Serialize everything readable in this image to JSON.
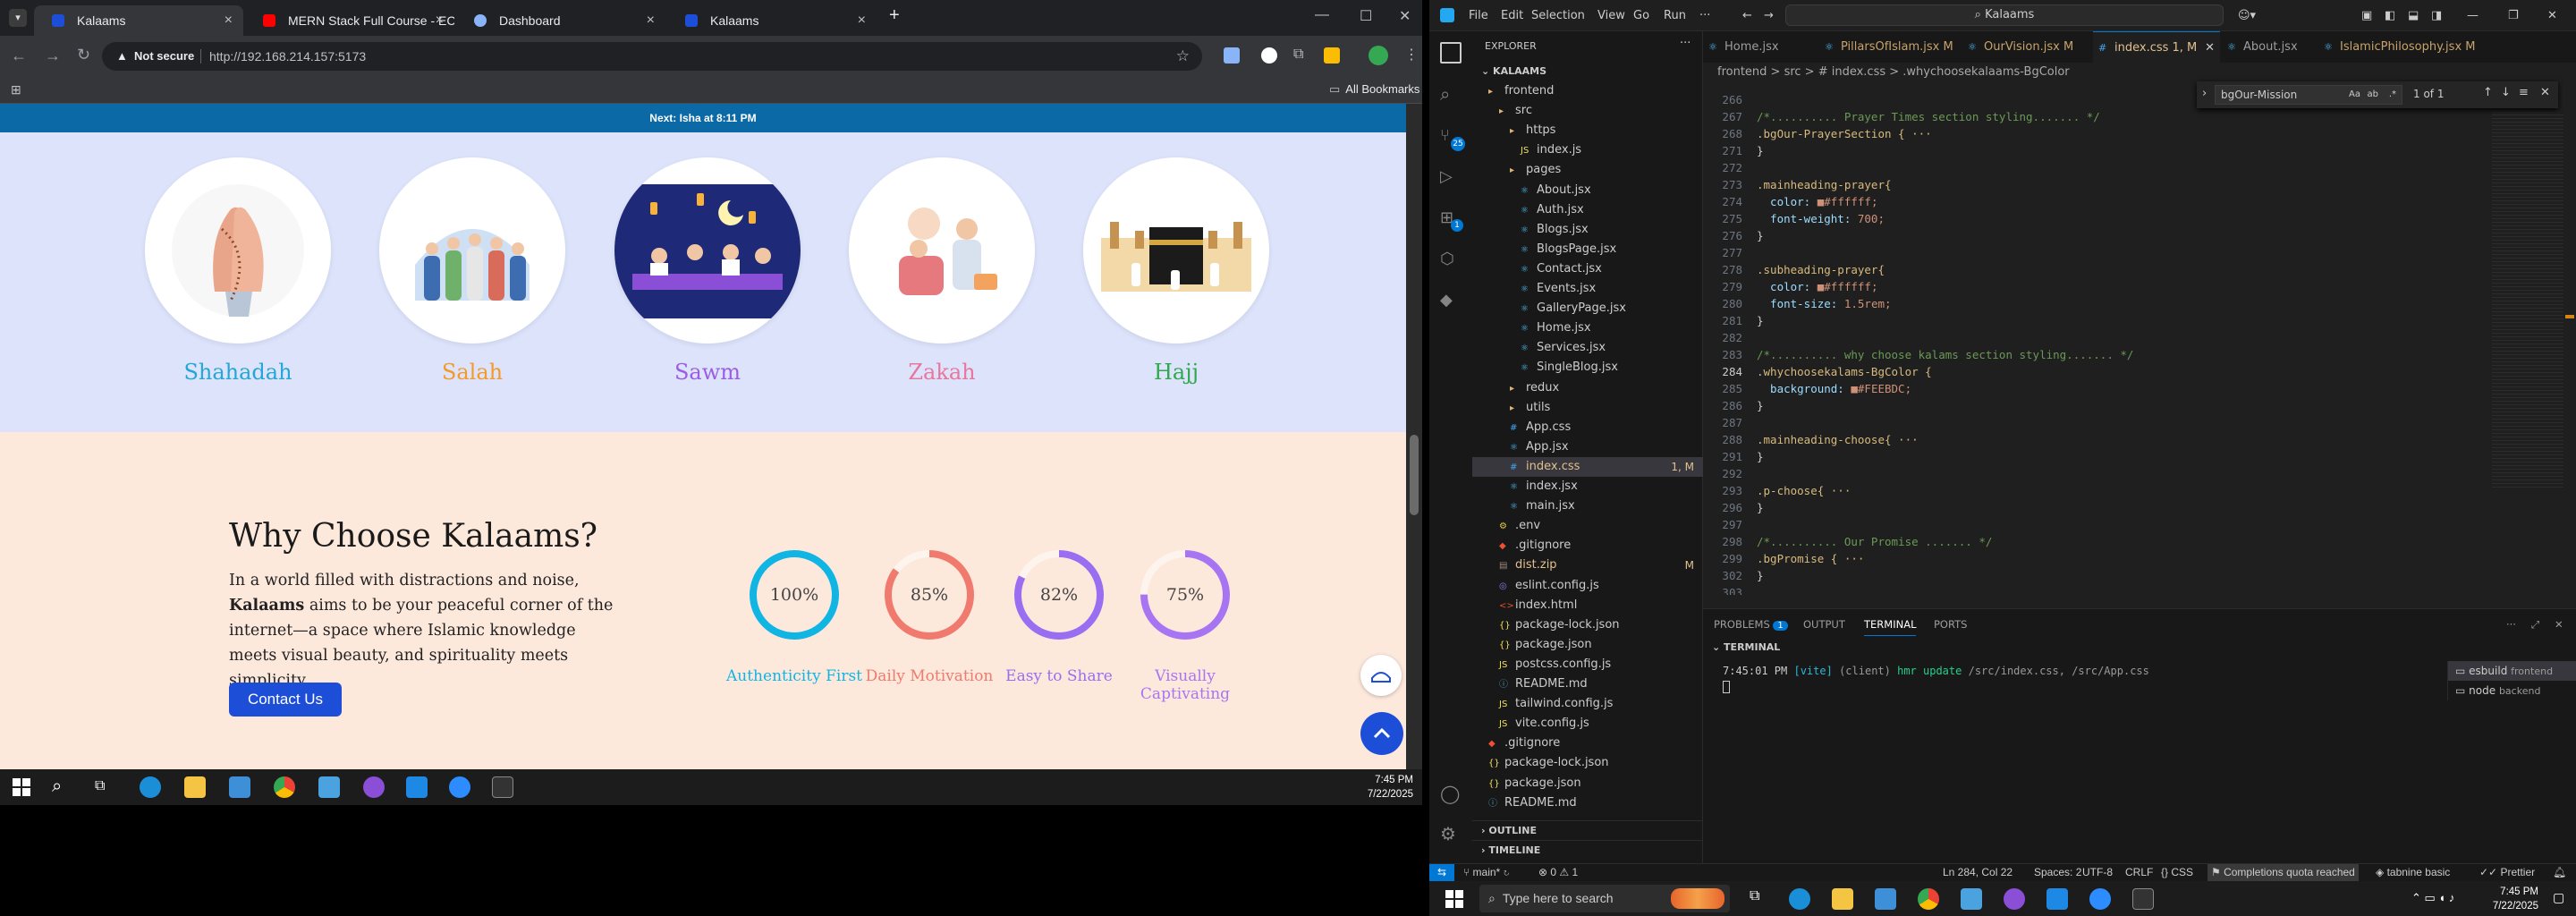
{
  "chrome": {
    "tabs": [
      {
        "title": "Kalaams",
        "active": true,
        "favicon_color": "#1d4ed8"
      },
      {
        "title": "MERN Stack Full Course - ECom",
        "active": false,
        "favicon_color": "#ff0000"
      },
      {
        "title": "Dashboard",
        "active": false,
        "favicon_color": "#8ab4f8"
      },
      {
        "title": "Kalaams",
        "active": false,
        "favicon_color": "#1d4ed8"
      }
    ],
    "not_secure": "Not secure",
    "url": "http://192.168.214.157:5173",
    "all_bookmarks": "All Bookmarks"
  },
  "site": {
    "next_prayer": "Next: Isha at 8:11 PM",
    "pillars": [
      {
        "label": "Shahadah",
        "color": "#22a7d6"
      },
      {
        "label": "Salah",
        "color": "#f39a2b"
      },
      {
        "label": "Sawm",
        "color": "#9b5de5"
      },
      {
        "label": "Zakah",
        "color": "#e8779d"
      },
      {
        "label": "Hajj",
        "color": "#2fa84f"
      }
    ],
    "why": {
      "heading": "Why Choose Kalaams?",
      "p1": "In a world filled with distractions and noise,",
      "brand": "Kalaams",
      "p2": " aims to be your peaceful corner of the internet—a space where Islamic knowledge meets visual beauty, and spirituality meets simplicity.",
      "button": "Contact Us"
    },
    "stats": [
      {
        "value": "100%",
        "fraction": 1.0,
        "label": "Authenticity First",
        "color": "#11b5e4"
      },
      {
        "value": "85%",
        "fraction": 0.85,
        "label": "Daily Motivation",
        "color": "#f07a6e"
      },
      {
        "value": "82%",
        "fraction": 0.82,
        "label": "Easy to Share",
        "color": "#9b6df0"
      },
      {
        "value": "75%",
        "fraction": 0.75,
        "label": "Visually Captivating",
        "color": "#a875f2"
      }
    ]
  },
  "taskbar_left": {
    "time": "7:45 PM",
    "date": "7/22/2025"
  },
  "vscode": {
    "menu": [
      "File",
      "Edit",
      "Selection",
      "View",
      "Go",
      "Run",
      "···"
    ],
    "command_center": "Kalaams",
    "explorer_title": "EXPLORER",
    "root": "KALAAMS",
    "tree": [
      {
        "name": "frontend",
        "type": "folder",
        "depth": 1
      },
      {
        "name": "src",
        "type": "folder",
        "depth": 2
      },
      {
        "name": "https",
        "type": "folder",
        "depth": 3
      },
      {
        "name": "index.js",
        "type": "js",
        "depth": 4
      },
      {
        "name": "pages",
        "type": "folder",
        "depth": 3
      },
      {
        "name": "About.jsx",
        "type": "jsx",
        "depth": 4
      },
      {
        "name": "Auth.jsx",
        "type": "jsx",
        "depth": 4
      },
      {
        "name": "Blogs.jsx",
        "type": "jsx",
        "depth": 4
      },
      {
        "name": "BlogsPage.jsx",
        "type": "jsx",
        "depth": 4
      },
      {
        "name": "Contact.jsx",
        "type": "jsx",
        "depth": 4
      },
      {
        "name": "Events.jsx",
        "type": "jsx",
        "depth": 4
      },
      {
        "name": "GalleryPage.jsx",
        "type": "jsx",
        "depth": 4
      },
      {
        "name": "Home.jsx",
        "type": "jsx",
        "depth": 4
      },
      {
        "name": "Services.jsx",
        "type": "jsx",
        "depth": 4
      },
      {
        "name": "SingleBlog.jsx",
        "type": "jsx",
        "depth": 4
      },
      {
        "name": "redux",
        "type": "folder",
        "depth": 3
      },
      {
        "name": "utils",
        "type": "folder",
        "depth": 3
      },
      {
        "name": "App.css",
        "type": "css",
        "depth": 3
      },
      {
        "name": "App.jsx",
        "type": "jsx",
        "depth": 3
      },
      {
        "name": "index.css",
        "type": "css",
        "depth": 3,
        "badge": "1, M"
      },
      {
        "name": "index.jsx",
        "type": "jsx",
        "depth": 3
      },
      {
        "name": "main.jsx",
        "type": "jsx",
        "depth": 3
      },
      {
        "name": ".env",
        "type": "env",
        "depth": 2
      },
      {
        "name": ".gitignore",
        "type": "git",
        "depth": 2
      },
      {
        "name": "dist.zip",
        "type": "zip",
        "depth": 2,
        "badge": "M"
      },
      {
        "name": "eslint.config.js",
        "type": "eslint",
        "depth": 2
      },
      {
        "name": "index.html",
        "type": "html",
        "depth": 2
      },
      {
        "name": "package-lock.json",
        "type": "json",
        "depth": 2
      },
      {
        "name": "package.json",
        "type": "json",
        "depth": 2
      },
      {
        "name": "postcss.config.js",
        "type": "js",
        "depth": 2
      },
      {
        "name": "README.md",
        "type": "md",
        "depth": 2
      },
      {
        "name": "tailwind.config.js",
        "type": "js",
        "depth": 2
      },
      {
        "name": "vite.config.js",
        "type": "js",
        "depth": 2
      },
      {
        "name": ".gitignore",
        "type": "git",
        "depth": 1
      },
      {
        "name": "package-lock.json",
        "type": "json",
        "depth": 1
      },
      {
        "name": "package.json",
        "type": "json",
        "depth": 1
      },
      {
        "name": "README.md",
        "type": "md",
        "depth": 1
      }
    ],
    "outline": "OUTLINE",
    "timeline": "TIMELINE",
    "editor_tabs": [
      {
        "name": "Home.jsx",
        "active": false
      },
      {
        "name": "PillarsOfIslam.jsx M",
        "active": false
      },
      {
        "name": "OurVision.jsx M",
        "active": false
      },
      {
        "name": "index.css 1, M",
        "active": true
      },
      {
        "name": "About.jsx",
        "active": false
      },
      {
        "name": "IslamicPhilosophy.jsx M",
        "active": false
      }
    ],
    "breadcrumb": "frontend > src > # index.css > .whychoosekalaams-BgColor",
    "find": {
      "query": "bgOur-Mission",
      "result": "1 of 1"
    },
    "code": [
      {
        "n": "266",
        "t": ""
      },
      {
        "n": "267",
        "t": "/*.......... Prayer Times section styling....... */",
        "c": "#6a9955"
      },
      {
        "n": "268",
        "t": ".bgOur-PrayerSection { ···",
        "c": "#d7ba7d"
      },
      {
        "n": "271",
        "t": "}"
      },
      {
        "n": "272",
        "t": ""
      },
      {
        "n": "273",
        "t": ".mainheading-prayer{",
        "c": "#d7ba7d"
      },
      {
        "n": "274",
        "t": "  color: ■#ffffff;"
      },
      {
        "n": "275",
        "t": "  font-weight: 700;"
      },
      {
        "n": "276",
        "t": "}"
      },
      {
        "n": "277",
        "t": ""
      },
      {
        "n": "278",
        "t": ".subheading-prayer{",
        "c": "#d7ba7d"
      },
      {
        "n": "279",
        "t": "  color: ■#ffffff;"
      },
      {
        "n": "280",
        "t": "  font-size: 1.5rem;"
      },
      {
        "n": "281",
        "t": "}"
      },
      {
        "n": "282",
        "t": ""
      },
      {
        "n": "283",
        "t": "/*.......... why choose kalams section styling....... */",
        "c": "#6a9955"
      },
      {
        "n": "284",
        "t": ".whychoosekalams-BgColor {",
        "c": "#d7ba7d"
      },
      {
        "n": "285",
        "t": "  background: ■#FEEBDC;"
      },
      {
        "n": "286",
        "t": "}"
      },
      {
        "n": "287",
        "t": ""
      },
      {
        "n": "288",
        "t": ".mainheading-choose{ ···",
        "c": "#d7ba7d"
      },
      {
        "n": "291",
        "t": "}"
      },
      {
        "n": "292",
        "t": ""
      },
      {
        "n": "293",
        "t": ".p-choose{ ···",
        "c": "#d7ba7d"
      },
      {
        "n": "296",
        "t": "}"
      },
      {
        "n": "297",
        "t": ""
      },
      {
        "n": "298",
        "t": "/*.......... Our Promise ....... */",
        "c": "#6a9955"
      },
      {
        "n": "299",
        "t": ".bgPromise { ···",
        "c": "#d7ba7d"
      },
      {
        "n": "302",
        "t": "}"
      },
      {
        "n": "303",
        "t": ""
      }
    ],
    "panel": {
      "tabs": [
        "PROBLEMS",
        "OUTPUT",
        "TERMINAL",
        "PORTS"
      ],
      "problems_count": "1",
      "section": "TERMINAL",
      "log_time": "7:45:01 PM",
      "log_tag": "[vite]",
      "log_client": "(client)",
      "log_hmr": "hmr update",
      "log_files": "/src/index.css, /src/App.css",
      "terminals": [
        {
          "name": "esbuild",
          "cwd": "frontend"
        },
        {
          "name": "node",
          "cwd": "backend"
        }
      ]
    },
    "status": {
      "branch": "main*",
      "errors": "0",
      "warnings": "1",
      "position": "Ln 284, Col 22",
      "spaces": "Spaces: 2",
      "encoding": "UTF-8",
      "eol": "CRLF",
      "lang": "CSS",
      "quota": "Completions quota reached",
      "tabnine": "tabnine basic",
      "prettier": "Prettier"
    }
  },
  "taskbar_right": {
    "search_placeholder": "Type here to search",
    "time": "7:45 PM",
    "date": "7/22/2025"
  }
}
